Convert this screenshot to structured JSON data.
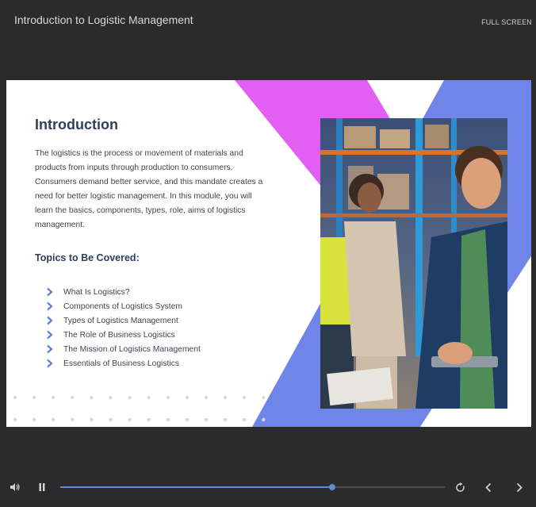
{
  "header": {
    "title": "Introduction to Logistic Management",
    "fullscreen_label": "FULL SCREEN"
  },
  "slide": {
    "heading": "Introduction",
    "paragraph": "The logistics is the process or movement of materials and products from inputs through production to consumers. Consumers demand better service, and this mandate creates a need for better logistic management. In this module, you will learn the basics, components, types, role, aims of logistics management.",
    "topics_heading": "Topics to Be Covered:",
    "topics": [
      "What Is Logistics?",
      "Components of Logistics System",
      "Types of Logistics Management",
      "The Role of Business Logistics",
      "The Mission of Logistics Management",
      "Essentials of Business Logistics"
    ],
    "colors": {
      "heading": "#2e3f5c",
      "accent_magenta": "#e15ff2",
      "accent_blue": "#6f86e8",
      "chevron": "#5b7fd1"
    }
  },
  "player": {
    "progress": 0.707,
    "icons": [
      "volume-icon",
      "pause-icon",
      "replay-icon",
      "previous-icon",
      "next-icon"
    ],
    "accent": "#5f8ed0"
  }
}
